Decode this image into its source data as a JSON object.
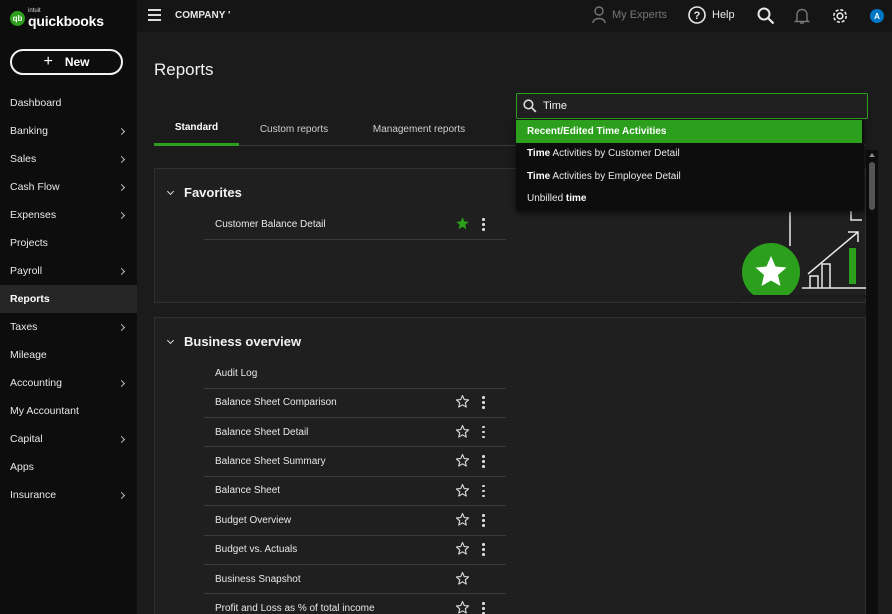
{
  "brand": {
    "intuit": "intuit",
    "name": "quickbooks",
    "logo_glyph": "qb",
    "accent": "#2ca01c"
  },
  "sidebar": {
    "new_label": "New",
    "items": [
      {
        "label": "Dashboard",
        "chevron": false
      },
      {
        "label": "Banking",
        "chevron": true
      },
      {
        "label": "Sales",
        "chevron": true
      },
      {
        "label": "Cash Flow",
        "chevron": true
      },
      {
        "label": "Expenses",
        "chevron": true
      },
      {
        "label": "Projects",
        "chevron": false
      },
      {
        "label": "Payroll",
        "chevron": true
      },
      {
        "label": "Reports",
        "chevron": false,
        "active": true
      },
      {
        "label": "Taxes",
        "chevron": true
      },
      {
        "label": "Mileage",
        "chevron": false
      },
      {
        "label": "Accounting",
        "chevron": true
      },
      {
        "label": "My Accountant",
        "chevron": false
      },
      {
        "label": "Capital",
        "chevron": true
      },
      {
        "label": "Apps",
        "chevron": false
      },
      {
        "label": "Insurance",
        "chevron": true
      }
    ]
  },
  "topbar": {
    "company": "COMPANY '",
    "my_experts": "My Experts",
    "help": "Help",
    "avatar_initial": "A"
  },
  "page": {
    "title": "Reports"
  },
  "tabs": [
    "Standard",
    "Custom reports",
    "Management reports"
  ],
  "search": {
    "value": "Time",
    "results": [
      {
        "bold": "",
        "rest": "Recent/Edited Time Activities",
        "highlighted": true
      },
      {
        "bold": "Time",
        "rest": " Activities by Customer Detail"
      },
      {
        "bold": "Time",
        "rest": " Activities by Employee Detail"
      },
      {
        "pre": "Unbilled ",
        "bold": "time",
        "rest": ""
      }
    ]
  },
  "favorites": {
    "title": "Favorites",
    "items": [
      {
        "label": "Customer Balance Detail",
        "starred": true
      }
    ]
  },
  "business_overview": {
    "title": "Business overview",
    "items": [
      {
        "label": "Audit Log",
        "star": false,
        "menu": false
      },
      {
        "label": "Balance Sheet Comparison",
        "star": true,
        "menu": true
      },
      {
        "label": "Balance Sheet Detail",
        "star": true,
        "menu": true
      },
      {
        "label": "Balance Sheet Summary",
        "star": true,
        "menu": true
      },
      {
        "label": "Balance Sheet",
        "star": true,
        "menu": true
      },
      {
        "label": "Budget Overview",
        "star": true,
        "menu": true
      },
      {
        "label": "Budget vs. Actuals",
        "star": true,
        "menu": true
      },
      {
        "label": "Business Snapshot",
        "star": true,
        "menu": false
      },
      {
        "label": "Profit and Loss as % of total income",
        "star": true,
        "menu": true
      }
    ]
  }
}
